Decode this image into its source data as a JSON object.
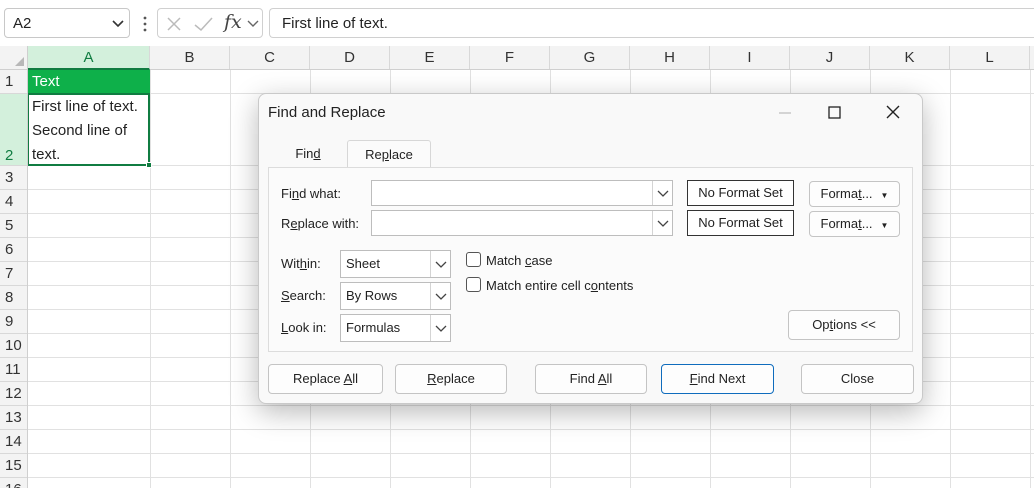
{
  "formula_bar": {
    "name_box": "A2",
    "formula": "First line of text."
  },
  "columns": [
    "A",
    "B",
    "C",
    "D",
    "E",
    "F",
    "G",
    "H",
    "I",
    "J",
    "K",
    "L"
  ],
  "rows": [
    "1",
    "2",
    "3",
    "4",
    "5",
    "6",
    "7",
    "8",
    "9",
    "10",
    "11",
    "12",
    "13",
    "14",
    "15"
  ],
  "cells": {
    "a1": "Text",
    "a2_lines": [
      "First line of text.",
      "Second line of",
      "text."
    ]
  },
  "dialog": {
    "title": "Find and Replace",
    "tabs": [
      {
        "label_pre": "Fin",
        "label_u": "d",
        "label_post": ""
      },
      {
        "label_pre": "Re",
        "label_u": "p",
        "label_post": "lace"
      }
    ],
    "find_what": {
      "label_pre": "Fi",
      "label_u": "n",
      "label_post": "d what:",
      "value": "",
      "format": "No Format Set"
    },
    "replace_with": {
      "label_pre": "R",
      "label_u": "e",
      "label_post": "place with:",
      "value": "",
      "format": "No Format Set"
    },
    "format_button": {
      "pre": "Forma",
      "u": "t",
      "post": "..."
    },
    "within": {
      "label_pre": "Wit",
      "label_u": "h",
      "label_post": "in:",
      "value": "Sheet"
    },
    "search": {
      "label_pre": "",
      "label_u": "S",
      "label_post": "earch:",
      "value": "By Rows"
    },
    "look_in": {
      "label_pre": "",
      "label_u": "L",
      "label_post": "ook in:",
      "value": "Formulas"
    },
    "match_case": {
      "pre": "Match ",
      "u": "c",
      "post": "ase",
      "checked": false
    },
    "match_entire": {
      "pre": "Match entire cell c",
      "u": "o",
      "post": "ntents",
      "checked": false
    },
    "options_button": {
      "pre": "Op",
      "u": "t",
      "post": "ions <<"
    },
    "buttons": {
      "replace_all": {
        "pre": "Replace ",
        "u": "A",
        "post": "ll"
      },
      "replace": {
        "pre": "",
        "u": "R",
        "post": "eplace"
      },
      "find_all": {
        "pre": "Find ",
        "u": "A",
        "post": "ll"
      },
      "find_next": {
        "pre": "",
        "u": "F",
        "post": "ind Next"
      },
      "close": {
        "pre": "Close",
        "u": "",
        "post": ""
      }
    }
  },
  "colors": {
    "accent_green": "#107c41",
    "header_fill": "#0eb04a",
    "selected_header": "#d3f0dc",
    "primary_border": "#0f6cbd"
  }
}
